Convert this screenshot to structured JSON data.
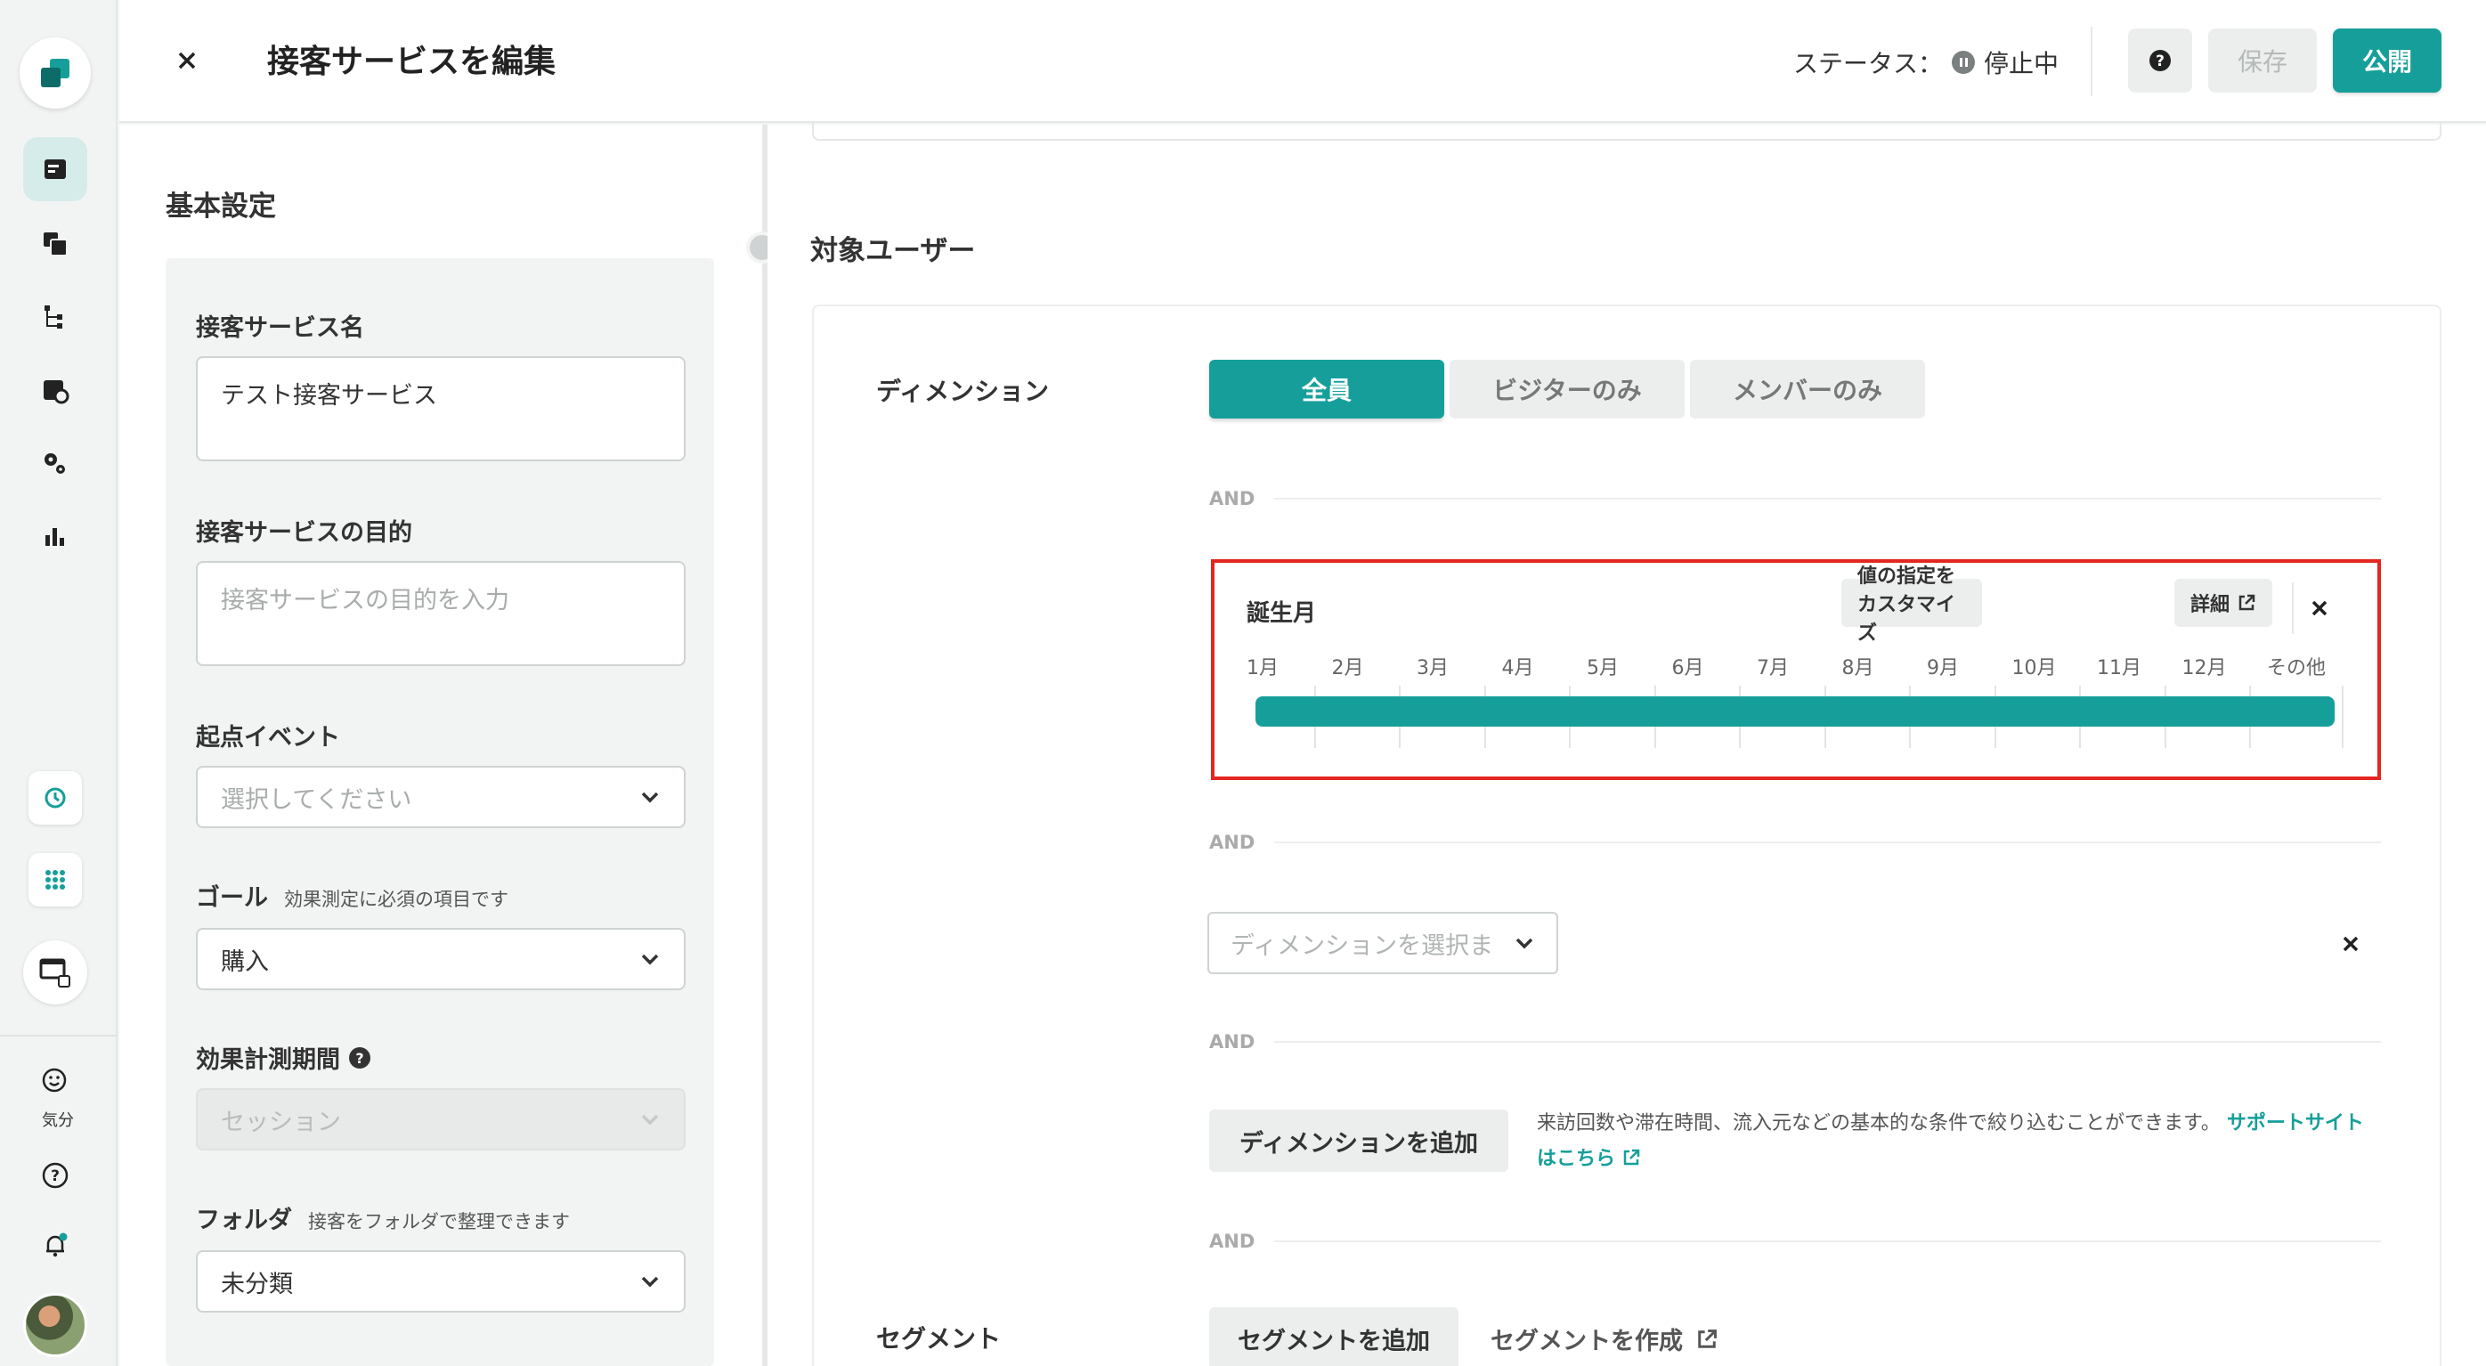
{
  "header": {
    "title": "接客サービスを編集",
    "status_label": "ステータス：",
    "status_value": "停止中",
    "save_label": "保存",
    "publish_label": "公開"
  },
  "left_panel": {
    "title": "基本設定",
    "name_label": "接客サービス名",
    "name_value": "テスト接客サービス",
    "purpose_label": "接客サービスの目的",
    "purpose_placeholder": "接客サービスの目的を入力",
    "start_event_label": "起点イベント",
    "start_event_placeholder": "選択してください",
    "goal_label": "ゴール",
    "goal_sub": "効果測定に必須の項目です",
    "goal_value": "購入",
    "period_label": "効果計測期間",
    "period_value": "セッション",
    "folder_label": "フォルダ",
    "folder_sub": "接客をフォルダで整理できます",
    "folder_value": "未分類"
  },
  "sidebar": {
    "mood_label": "気分"
  },
  "target": {
    "section_title": "対象ユーザー",
    "dimension_label": "ディメンション",
    "tabs": [
      "全員",
      "ビジターのみ",
      "メンバーのみ"
    ],
    "active_tab": 0,
    "and_label": "AND",
    "birthday": {
      "title": "誕生月",
      "customize_label": "値の指定をカスタマイズ",
      "detail_label": "詳細",
      "months": [
        "1月",
        "2月",
        "3月",
        "4月",
        "5月",
        "6月",
        "7月",
        "8月",
        "9月",
        "10月",
        "11月",
        "12月",
        "その他"
      ],
      "selected_range": [
        "1月",
        "その他"
      ]
    },
    "dimension_select_placeholder": "ディメンションを選択ま",
    "add_dimension_label": "ディメンションを追加",
    "add_dimension_desc": "来訪回数や滞在時間、流入元などの基本的な条件で絞り込むことができます。",
    "support_link": "サポートサイトはこちら",
    "segment_label": "セグメント",
    "add_segment_label": "セグメントを追加",
    "create_segment_label": "セグメントを作成"
  },
  "colors": {
    "accent": "#169f9a",
    "highlight_border": "#e3261f"
  }
}
